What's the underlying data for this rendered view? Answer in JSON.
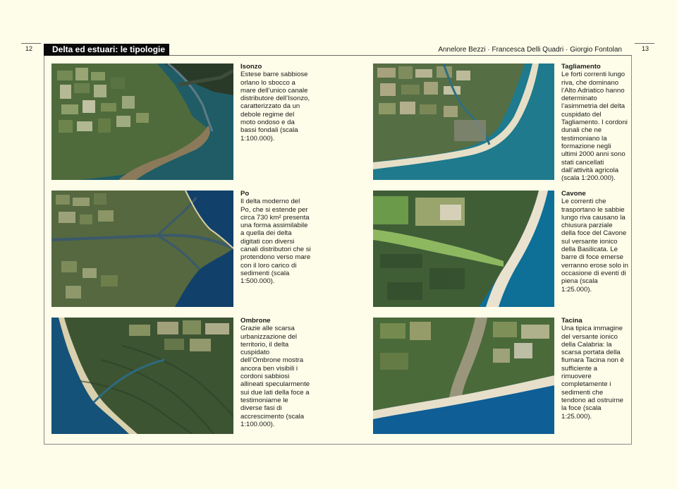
{
  "page": {
    "left_number": "12",
    "right_number": "13",
    "section_title": "Delta ed estuari: le tipologie",
    "authors": "Annelore Bezzi · Francesca Delli Quadri · Giorgio Fontolan"
  },
  "figures": [
    {
      "title": "Isonzo",
      "text": "Estese barre sabbiose orlano lo sbocco a mare dell’unico canale distributore dell’Isonzo, caratterizzato da un debole regime del moto ondoso e da bassi fondali (scala 1:100.000).",
      "image": "satellite-image-isonzo"
    },
    {
      "title": "Tagliamento",
      "text": "Le forti correnti lungo riva, che dominano l’Alto Adriatico hanno determinato l’asimmetria del delta cuspidato del Tagliamento. I cordoni dunali che ne testimoniano la formazione negli ultimi 2000 anni sono stati cancellati dall’attività agricola (scala 1:200.000).",
      "image": "satellite-image-tagliamento"
    },
    {
      "title": "Po",
      "text": "Il delta moderno del Po, che si estende per circa 730 km² presenta una forma assimilabile a quella dei delta digitati con diversi canali distributori che si protendono verso mare con il loro carico di sedimenti (scala 1:500.000).",
      "image": "satellite-image-po"
    },
    {
      "title": "Cavone",
      "text": "Le correnti che trasportano le sabbie lungo riva causano la chiusura parziale della foce del Cavone sul versante ionico della Basilicata. Le barre di foce emerse verranno erose solo in occasione di eventi di piena (scala 1:25.000).",
      "image": "satellite-image-cavone"
    },
    {
      "title": "Ombrone",
      "text": "Grazie alle scarsa urbanizzazione del territorio, il delta cuspidato dell’Ombrone mostra ancora ben visibili i cordoni sabbiosi allineati specularmente sui due lati della foce a testimoniarne le diverse fasi di accrescimento (scala 1:100.000).",
      "image": "satellite-image-ombrone"
    },
    {
      "title": "Tacina",
      "text": "Una tipica immagine del versante ionico della Calabria: la scarsa portata della fiumara Tacina non è sufficiente a rimuovere completamente i sedimenti che tendono ad ostruirne la foce (scala 1:25.000).",
      "image": "satellite-image-tacina"
    }
  ]
}
